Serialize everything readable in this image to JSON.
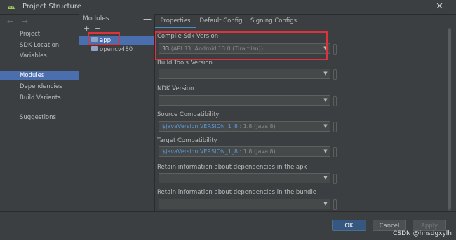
{
  "window": {
    "title": "Project Structure",
    "close_glyph": "✕"
  },
  "nav": {
    "back_forward": "← →",
    "items": [
      {
        "label": "Project"
      },
      {
        "label": "SDK Location"
      },
      {
        "label": "Variables"
      },
      {
        "label": "Modules",
        "selected": true
      },
      {
        "label": "Dependencies"
      },
      {
        "label": "Build Variants"
      },
      {
        "label": "Suggestions"
      }
    ]
  },
  "modules": {
    "header": "Modules",
    "collapse_glyph": "—",
    "add_glyph": "+",
    "remove_glyph": "−",
    "items": [
      {
        "name": "app",
        "selected": true
      },
      {
        "name": "opencv480"
      }
    ]
  },
  "tabs": [
    {
      "label": "Properties",
      "active": true
    },
    {
      "label": "Default Config"
    },
    {
      "label": "Signing Configs"
    }
  ],
  "properties": {
    "compile_sdk": {
      "label": "Compile Sdk Version",
      "value": "33",
      "hint": " (API 33: Android 13.0 (Tiramisu))"
    },
    "build_tools": {
      "label": "Build Tools Version",
      "value": ""
    },
    "ndk": {
      "label": "NDK Version",
      "value": ""
    },
    "source_compat": {
      "label": "Source Compatibility",
      "value": "$JavaVersion.VERSION_1_8",
      "hint": " : 1.8 (Java 8)"
    },
    "target_compat": {
      "label": "Target Compatibility",
      "value": "$JavaVersion.VERSION_1_8",
      "hint": " : 1.8 (Java 8)"
    },
    "deps_apk": {
      "label": "Retain information about dependencies in the apk",
      "value": ""
    },
    "deps_bundle": {
      "label": "Retain information about dependencies in the bundle",
      "value": ""
    }
  },
  "buttons": {
    "ok": "OK",
    "cancel": "Cancel",
    "apply": "Apply"
  },
  "watermark": "CSDN @hnsdgxylh",
  "colors": {
    "accent": "#4b6eaf",
    "highlight": "#e0323b",
    "value_text": "#5a97d6"
  }
}
